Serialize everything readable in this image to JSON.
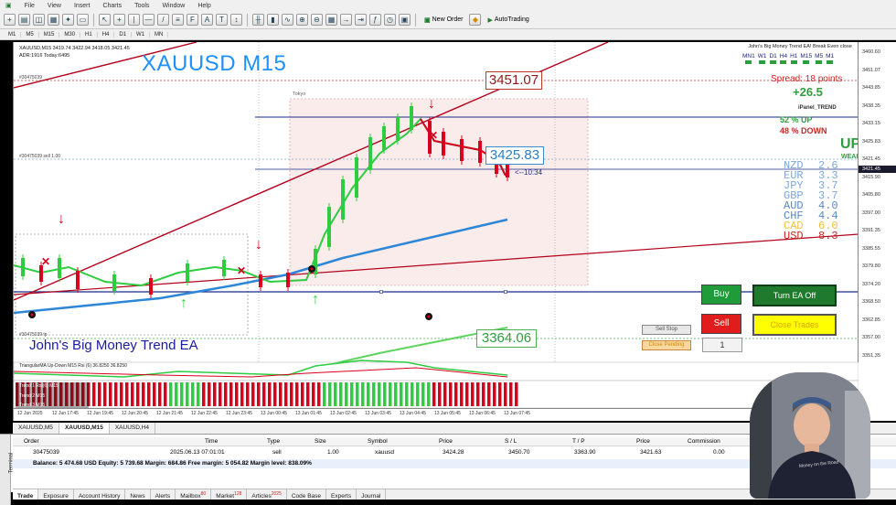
{
  "menu": [
    "File",
    "View",
    "Insert",
    "Charts",
    "Tools",
    "Window",
    "Help"
  ],
  "toolbar": {
    "new_order": "New Order",
    "autotrading": "AutoTrading"
  },
  "timeframes": [
    "M1",
    "M5",
    "M15",
    "M30",
    "H1",
    "H4",
    "D1",
    "W1",
    "MN"
  ],
  "chart": {
    "ohlc": "XAUUSD,M15  3419.74 3422.94 3418.05 3421.45",
    "adr": "ADR:1916  Today:6495",
    "symbol_big": "XAUUSD M15",
    "ea_title": "John's Big Money Trend EA",
    "session": "Tokyo",
    "price_top": "3451.07",
    "price_mid": "3425.83",
    "price_low": "3364.06",
    "timer": "<--10:34",
    "order_label_1": "#30475039",
    "order_label_2": "#30475039 sell 1.00",
    "order_label_3": "#30475039 tp",
    "ind_label_1": "TriangularMA Up-Down  M15 Rsi (6) 36.8250 36.8250",
    "ind_label_2": "Trend 1 Rsi(6) M15",
    "ind_label_3": "Trend 2 M15",
    "ind_label_4": "Trend 3 M15"
  },
  "yaxis": [
    "3460.60",
    "3451.07",
    "3443.85",
    "3438.35",
    "3433.15",
    "3425.83",
    "3421.45",
    "3415.90",
    "3405.80",
    "3397.00",
    "3391.35",
    "3385.55",
    "3379.80",
    "3374.20",
    "3368.50",
    "3362.85",
    "3357.00",
    "3351.35"
  ],
  "xaxis": [
    "12 Jun 2025",
    "12 Jun 17:45",
    "12 Jun 19:45",
    "12 Jun 20:45",
    "12 Jun 21:45",
    "12 Jun 22:45",
    "12 Jun 23:45",
    "13 Jun 00:45",
    "13 Jun 01:45",
    "13 Jun 02:45",
    "13 Jun 03:45",
    "13 Jun 04:45",
    "13 Jun 05:45",
    "13 Jun 06:45",
    "13 Jun 07:45"
  ],
  "panel": {
    "title": "John's Big Money Trend EA! Break Even close",
    "tfs": [
      "MN1",
      "W1",
      "D1",
      "H4",
      "H1",
      "M15",
      "M5",
      "M1"
    ],
    "spread": "Spread: 18 points",
    "spread_val": "+26.5",
    "ipanel": "iPanel_TREND",
    "pct_up": "52 %      UP",
    "pct_down": "48 %  DOWN",
    "up_big": "UP",
    "weak": "WEAK",
    "currencies": [
      {
        "name": "NZD",
        "val": "2.6",
        "color": "#7fa7d8"
      },
      {
        "name": "EUR",
        "val": "3.3",
        "color": "#7fa7d8"
      },
      {
        "name": "JPY",
        "val": "3.7",
        "color": "#7fa7d8"
      },
      {
        "name": "GBP",
        "val": "3.7",
        "color": "#7fa7d8"
      },
      {
        "name": "AUD",
        "val": "4.0",
        "color": "#5b86c8"
      },
      {
        "name": "CHF",
        "val": "4.4",
        "color": "#5b86c8"
      },
      {
        "name": "CAD",
        "val": "6.0",
        "color": "#f0c040"
      },
      {
        "name": "USD",
        "val": "8.3",
        "color": "#c62828"
      }
    ]
  },
  "buttons": {
    "buy": "Buy",
    "sell": "Sell",
    "turn_off": "Turn EA Off",
    "close_trades": "Close Trades",
    "sell_stop": "Sell Stop",
    "close_pending": "Close Pending",
    "lots": "1"
  },
  "chart_tabs": [
    "XAUUSD,M5",
    "XAUUSD,M15",
    "XAUUSD,H4"
  ],
  "terminal": {
    "headers": [
      "Order",
      "Time",
      "Type",
      "Size",
      "Symbol",
      "Price",
      "S / L",
      "T / P",
      "Price",
      "Commission"
    ],
    "row": [
      "30475039",
      "2025.06.13 07:01:01",
      "sell",
      "1.00",
      "xauusd",
      "3424.28",
      "3450.70",
      "3363.90",
      "3421.63",
      "0.00"
    ],
    "balance": "Balance: 5 474.68 USD  Equity: 5 739.68  Margin: 684.86  Free margin: 5 054.82  Margin level: 838.09%",
    "side_label": "Terminal"
  },
  "bottom_tabs": [
    {
      "label": "Trade",
      "badge": ""
    },
    {
      "label": "Exposure",
      "badge": ""
    },
    {
      "label": "Account History",
      "badge": ""
    },
    {
      "label": "News",
      "badge": ""
    },
    {
      "label": "Alerts",
      "badge": ""
    },
    {
      "label": "Mailbox",
      "badge": "80"
    },
    {
      "label": "Market",
      "badge": "128"
    },
    {
      "label": "Articles",
      "badge": "2025"
    },
    {
      "label": "Code Base",
      "badge": ""
    },
    {
      "label": "Experts",
      "badge": ""
    },
    {
      "label": "Journal",
      "badge": ""
    }
  ]
}
